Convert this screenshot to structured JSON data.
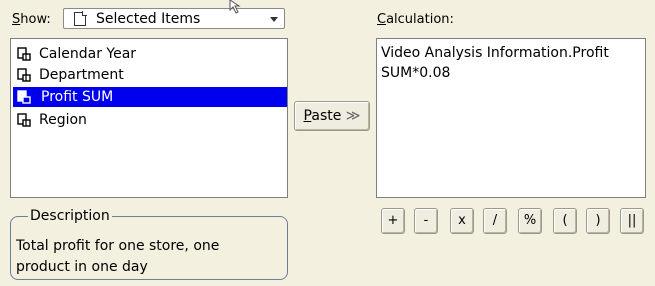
{
  "show": {
    "label_prefix": "S",
    "label_rest": "how:",
    "selected": "Selected Items"
  },
  "items": [
    {
      "label": "Calendar Year",
      "selected": false
    },
    {
      "label": "Department",
      "selected": false
    },
    {
      "label": "Profit SUM",
      "selected": true
    },
    {
      "label": "Region",
      "selected": false
    }
  ],
  "paste": {
    "label_prefix": "P",
    "label_rest": "aste",
    "glyph": "≫"
  },
  "description": {
    "title": "Description",
    "text": "Total profit for one store, one product in one day"
  },
  "calculation": {
    "label_prefix": "C",
    "label_rest": "alculation:",
    "value": "Video Analysis Information.Profit\nSUM*0.08"
  },
  "operators": [
    "+",
    "-",
    "x",
    "/",
    "%",
    "(",
    ")",
    "||"
  ],
  "icons": {
    "dropdown_item": "document-icon",
    "list_item": "field-icon",
    "paste": "double-chevron-right-icon"
  }
}
